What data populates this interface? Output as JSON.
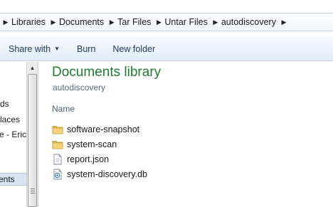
{
  "breadcrumb": {
    "items": [
      "Libraries",
      "Documents",
      "Tar Files",
      "Untar Files",
      "autodiscovery"
    ]
  },
  "toolbar": {
    "share_with": "Share with",
    "burn": "Burn",
    "new_folder": "New folder"
  },
  "nav": {
    "items": [
      "ds",
      "laces",
      "e - Erics",
      "ents"
    ]
  },
  "library": {
    "title": "Documents library",
    "subtitle": "autodiscovery",
    "column_name": "Name"
  },
  "files": [
    {
      "name": "software-snapshot",
      "icon": "folder-icon"
    },
    {
      "name": "system-scan",
      "icon": "folder-icon"
    },
    {
      "name": "report.json",
      "icon": "document-icon"
    },
    {
      "name": "system-discovery.db",
      "icon": "database-file-icon"
    }
  ],
  "colors": {
    "title_green": "#1e7d33",
    "toolbar_text": "#1e395b",
    "folder_yellow": "#e8c25a"
  }
}
